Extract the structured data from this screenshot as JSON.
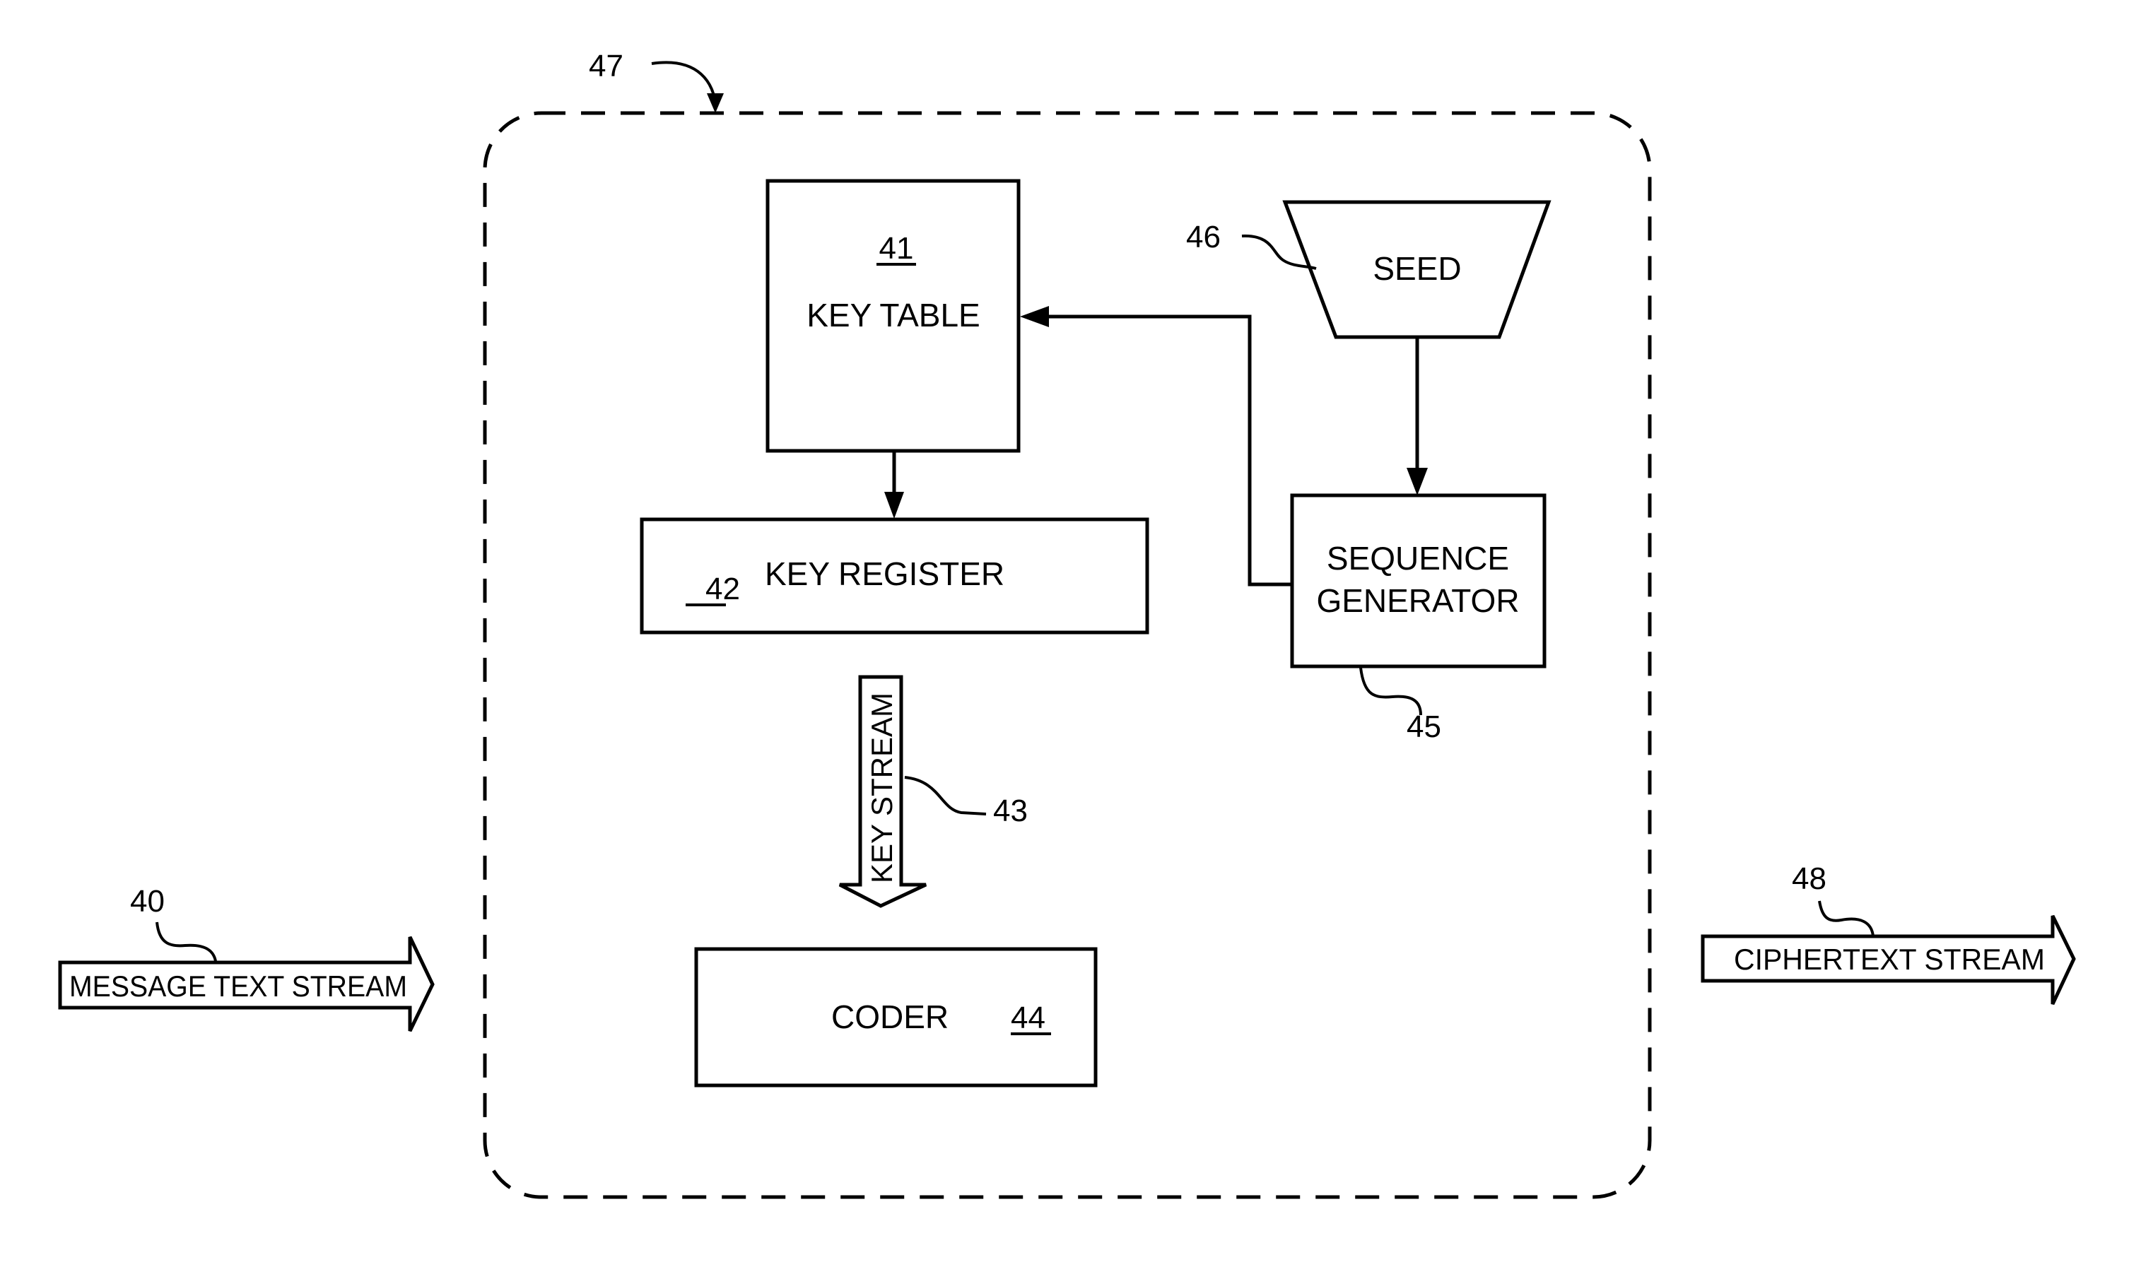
{
  "diagram": {
    "container": {
      "ref": "47"
    },
    "key_table": {
      "ref": "41",
      "label": "KEY TABLE"
    },
    "key_register": {
      "ref": "42",
      "label": "KEY REGISTER"
    },
    "key_stream": {
      "ref": "43",
      "label": "KEY STREAM"
    },
    "coder": {
      "ref": "44",
      "label": "CODER"
    },
    "sequence_generator": {
      "ref": "45",
      "label_line1": "SEQUENCE",
      "label_line2": "GENERATOR"
    },
    "seed": {
      "ref": "46",
      "label": "SEED"
    },
    "message_stream": {
      "ref": "40",
      "label": "MESSAGE TEXT STREAM"
    },
    "ciphertext_stream": {
      "ref": "48",
      "label": "CIPHERTEXT STREAM"
    },
    "connections": [
      {
        "from": "seed",
        "to": "sequence_generator"
      },
      {
        "from": "sequence_generator",
        "to": "key_table"
      },
      {
        "from": "key_table",
        "to": "key_register"
      },
      {
        "from": "key_register",
        "to": "coder",
        "via": "key_stream"
      }
    ]
  }
}
